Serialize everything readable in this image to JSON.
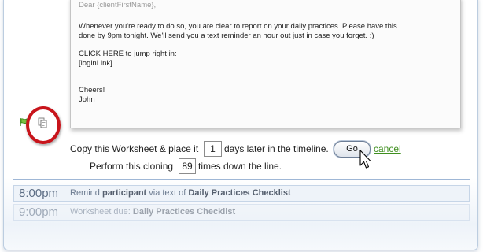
{
  "email": {
    "greeting": "Dear {clientFirstName},",
    "lines": [
      "Whenever you're ready to do so, you are clear to report on your daily practices.  Please have this",
      "done by 9pm tonight.  We'll send you a text reminder an hour out just in case you forget. :)",
      "CLICK HERE to jump right in:",
      "[loginLink]",
      "Cheers!",
      "John"
    ]
  },
  "icons": [
    "green-flag-icon",
    "copy-icon",
    "mouse-cursor-icon"
  ],
  "colors": {
    "highlight_circle": "#c8141b",
    "link_green": "#3f8f1f",
    "border_blue": "#9fb7d6"
  },
  "clone_form": {
    "line1_prefix": "Copy this Worksheet & place it",
    "days_value": "1",
    "line1_suffix": "days later in the timeline.",
    "go_label": "Go",
    "cancel_label": "cancel",
    "line2_prefix": "Perform this cloning",
    "times_value": "89",
    "line2_suffix": "times down the line."
  },
  "timeline": [
    {
      "time": "8:00pm",
      "prefix": "Remind ",
      "bold1": "participant",
      "mid": " via text of ",
      "bold2": "Daily Practices Checklist"
    },
    {
      "time": "9:00pm",
      "prefix": "Worksheet due: ",
      "bold1": "",
      "mid": "",
      "bold2": "Daily Practices Checklist"
    }
  ]
}
